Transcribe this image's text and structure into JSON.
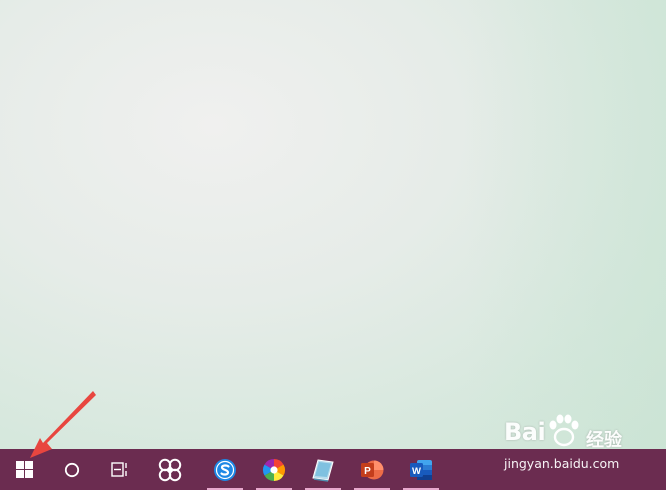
{
  "desktop": {
    "background": "#e8ede9"
  },
  "annotation": {
    "color": "#e8463f",
    "points_to": "start-button"
  },
  "taskbar": {
    "background": "#6b2c50",
    "indicator_color": "#e7a9cd",
    "system_buttons": [
      {
        "name": "start",
        "icon": "windows-logo-icon"
      },
      {
        "name": "search",
        "icon": "cortana-circle-icon"
      },
      {
        "name": "task-view",
        "icon": "task-view-icon"
      }
    ],
    "pinned_apps": [
      {
        "name": "pinwheel-app",
        "icon": "pinwheel-icon",
        "running": false
      },
      {
        "name": "sogou-browser",
        "icon": "sogou-s-icon",
        "running": true
      },
      {
        "name": "color-wheel-app",
        "icon": "color-wheel-icon",
        "running": true
      },
      {
        "name": "notepad-app",
        "icon": "notepad-icon",
        "running": true
      },
      {
        "name": "powerpoint",
        "icon": "powerpoint-icon",
        "label": "P",
        "running": true
      },
      {
        "name": "word",
        "icon": "word-icon",
        "label": "W",
        "running": true
      }
    ]
  },
  "watermark": {
    "brand_left": "Bai",
    "brand_cn": "经验",
    "url": "jingyan.baidu.com"
  }
}
